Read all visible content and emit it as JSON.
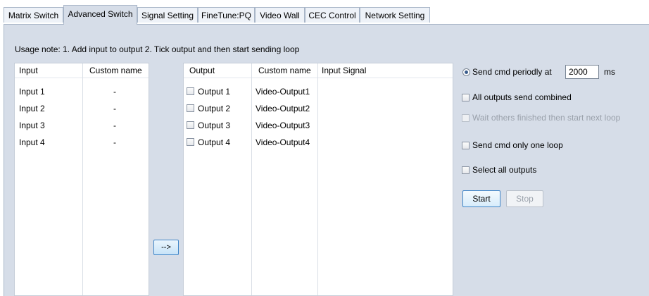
{
  "tabs": [
    {
      "label": "Matrix Switch",
      "active": false
    },
    {
      "label": "Advanced Switch",
      "active": true
    },
    {
      "label": "Signal Setting",
      "active": false
    },
    {
      "label": "FineTune:PQ",
      "active": false
    },
    {
      "label": "Video Wall",
      "active": false
    },
    {
      "label": "CEC Control",
      "active": false
    },
    {
      "label": "Network Setting",
      "active": false
    }
  ],
  "usage_note": "Usage note: 1. Add input to output   2. Tick output and then start sending loop",
  "input_table": {
    "headers": [
      "Input",
      "Custom name"
    ],
    "rows": [
      {
        "input": "Input  1",
        "custom": "-"
      },
      {
        "input": "Input  2",
        "custom": "-"
      },
      {
        "input": "Input  3",
        "custom": "-"
      },
      {
        "input": "Input  4",
        "custom": "-"
      }
    ]
  },
  "add_button": "-->",
  "output_table": {
    "headers": [
      "Output",
      "Custom name",
      "Input Signal"
    ],
    "rows": [
      {
        "output": "Output  1",
        "custom": "Video-Output1",
        "signal": "",
        "checked": false
      },
      {
        "output": "Output  2",
        "custom": "Video-Output2",
        "signal": "",
        "checked": false
      },
      {
        "output": "Output  3",
        "custom": "Video-Output3",
        "signal": "",
        "checked": false
      },
      {
        "output": "Output  4",
        "custom": "Video-Output4",
        "signal": "",
        "checked": false
      }
    ]
  },
  "options": {
    "send_periodic_label": "Send cmd periodly at",
    "send_periodic_value": "2000",
    "send_periodic_unit": "ms",
    "all_outputs_combined": "All outputs send combined",
    "wait_others": "Wait others finished then start next loop",
    "send_one_loop": "Send cmd only one loop",
    "select_all": "Select all outputs"
  },
  "buttons": {
    "start": "Start",
    "stop": "Stop"
  },
  "colors": {
    "panel": "#d6dde8",
    "accent_border": "#3f85c8"
  }
}
